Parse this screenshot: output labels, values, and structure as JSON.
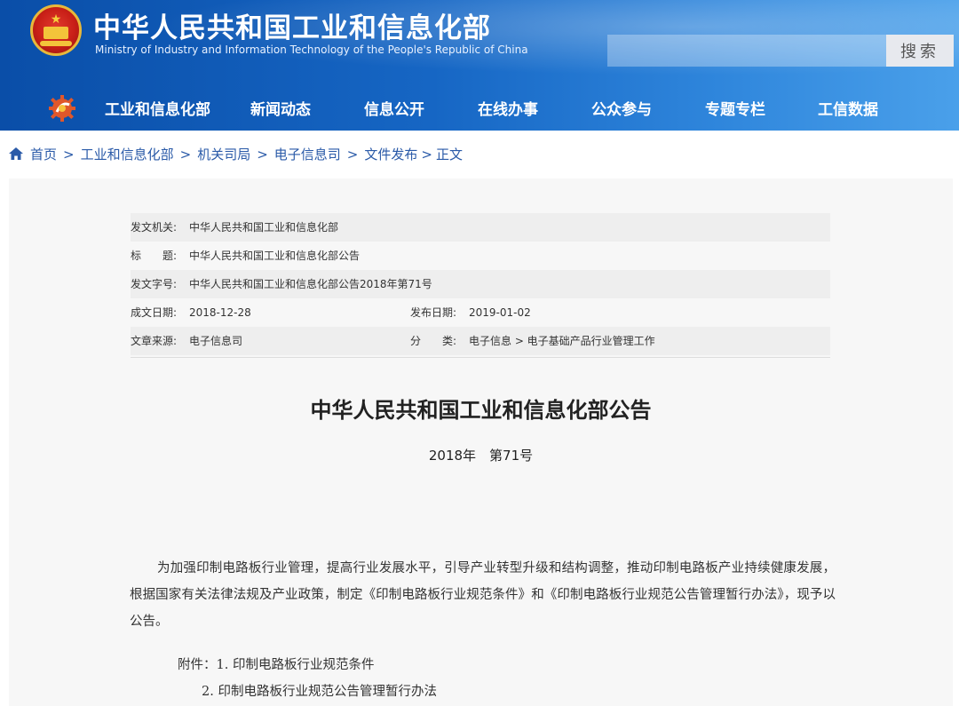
{
  "header": {
    "title_cn": "中华人民共和国工业和信息化部",
    "title_en": "Ministry of Industry and Information Technology of the People's Republic of China",
    "search_placeholder": "",
    "search_label": "搜索"
  },
  "nav": {
    "items": [
      {
        "label": "工业和信息化部"
      },
      {
        "label": "新闻动态"
      },
      {
        "label": "信息公开"
      },
      {
        "label": "在线办事"
      },
      {
        "label": "公众参与"
      },
      {
        "label": "专题专栏"
      },
      {
        "label": "工信数据"
      }
    ]
  },
  "breadcrumb": {
    "items": [
      "首页",
      "工业和信息化部",
      "机关司局",
      "电子信息司",
      "文件发布",
      "正文"
    ],
    "separator": ">"
  },
  "meta": {
    "issuer_label": "发文机关:",
    "issuer": "中华人民共和国工业和信息化部",
    "title_label": "标　　题:",
    "title": "中华人民共和国工业和信息化部公告",
    "docno_label": "发文字号:",
    "docno": "中华人民共和国工业和信息化部公告2018年第71号",
    "written_label": "成文日期:",
    "written": "2018-12-28",
    "published_label": "发布日期:",
    "published": "2019-01-02",
    "source_label": "文章来源:",
    "source": "电子信息司",
    "category_label": "分　　类:",
    "category": "电子信息 > 电子基础产品行业管理工作"
  },
  "document": {
    "title": "中华人民共和国工业和信息化部公告",
    "number": "2018年　第71号",
    "body": "为加强印制电路板行业管理，提高行业发展水平，引导产业转型升级和结构调整，推动印制电路板产业持续健康发展，根据国家有关法律法规及产业政策，制定《印制电路板行业规范条件》和《印制电路板行业规范公告管理暂行办法》，现予以公告。",
    "attachment_1": "附件：1. 印制电路板行业规范条件",
    "attachment_2": "2. 印制电路板行业规范公告管理暂行办法"
  },
  "colors": {
    "header_blue": "#1666c4",
    "link_blue": "#2a5aa8",
    "panel_bg": "#f7f7f7",
    "emblem_red": "#c81f17",
    "emblem_gold": "#f3c43a"
  },
  "icons": {
    "emblem": "national-emblem-icon",
    "nav": "gear-logo-icon",
    "home": "home-icon"
  }
}
